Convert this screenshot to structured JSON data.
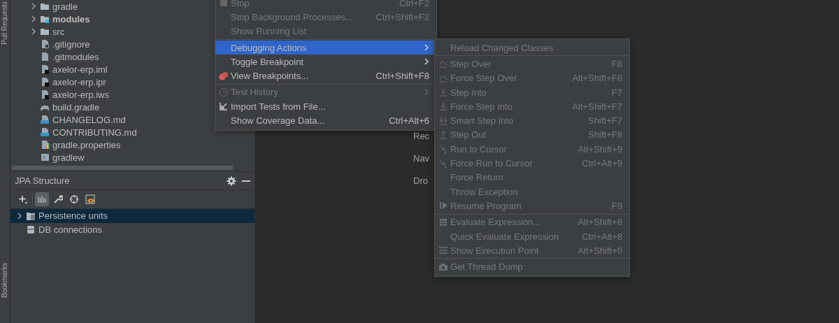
{
  "side_stripe": {
    "top_label": "Pull Requests",
    "bottom_label": "Bookmarks"
  },
  "project_tree": {
    "items": [
      {
        "label": "gradle",
        "kind": "folder",
        "expandable": true,
        "bold": false
      },
      {
        "label": "modules",
        "kind": "module",
        "expandable": true,
        "bold": true
      },
      {
        "label": "src",
        "kind": "folder",
        "expandable": true,
        "bold": false
      },
      {
        "label": ".gitignore",
        "kind": "ignore",
        "expandable": false,
        "bold": false
      },
      {
        "label": ".gitmodules",
        "kind": "text",
        "expandable": false,
        "bold": false
      },
      {
        "label": "axelor-erp.iml",
        "kind": "ide",
        "expandable": false,
        "bold": false
      },
      {
        "label": "axelor-erp.ipr",
        "kind": "ide",
        "expandable": false,
        "bold": false
      },
      {
        "label": "axelor-erp.iws",
        "kind": "ide",
        "expandable": false,
        "bold": false
      },
      {
        "label": "build.gradle",
        "kind": "gradle",
        "expandable": false,
        "bold": false
      },
      {
        "label": "CHANGELOG.md",
        "kind": "markdown",
        "expandable": false,
        "bold": false
      },
      {
        "label": "CONTRIBUTING.md",
        "kind": "markdown",
        "expandable": false,
        "bold": false
      },
      {
        "label": "gradle.properties",
        "kind": "properties",
        "expandable": false,
        "bold": false
      },
      {
        "label": "gradlew",
        "kind": "script",
        "expandable": false,
        "bold": false
      }
    ]
  },
  "jpa_panel": {
    "title": "JPA Structure",
    "toolbar": [
      {
        "kind": "add",
        "selected": false
      },
      {
        "kind": "bars",
        "selected": true
      },
      {
        "kind": "wrench",
        "selected": false
      },
      {
        "kind": "target",
        "selected": false
      },
      {
        "kind": "preview",
        "selected": false
      }
    ],
    "items": [
      {
        "label": "Persistence units",
        "kind": "units",
        "expandable": true,
        "selected": true
      },
      {
        "label": "DB connections",
        "kind": "database",
        "expandable": false,
        "selected": false
      }
    ]
  },
  "editor_hints": [
    "Rec",
    "Nav",
    "Dro"
  ],
  "run_menu": {
    "items": [
      {
        "kind": "item",
        "label": "Stop",
        "shortcut": "Ctrl+F2",
        "disabled": true,
        "selected": false,
        "submenu": false
      },
      {
        "kind": "item",
        "label": "Stop Background Processes...",
        "shortcut": "Ctrl+Shift+F2",
        "disabled": true,
        "selected": false,
        "submenu": false
      },
      {
        "kind": "item",
        "label": "Show Running List",
        "disabled": true,
        "selected": false,
        "submenu": false
      },
      {
        "kind": "separator"
      },
      {
        "kind": "item",
        "label": "Debugging Actions",
        "disabled": false,
        "selected": true,
        "submenu": true
      },
      {
        "kind": "item",
        "label": "Toggle Breakpoint",
        "disabled": false,
        "selected": false,
        "submenu": true
      },
      {
        "kind": "item",
        "label": "View Breakpoints...",
        "shortcut": "Ctrl+Shift+F8",
        "disabled": false,
        "selected": false,
        "submenu": false
      },
      {
        "kind": "separator"
      },
      {
        "kind": "item",
        "label": "Test History",
        "disabled": true,
        "selected": false,
        "submenu": true
      },
      {
        "kind": "item",
        "label": "Import Tests from File...",
        "disabled": false,
        "selected": false,
        "submenu": false
      },
      {
        "kind": "item",
        "label": "Show Coverage Data...",
        "shortcut": "Ctrl+Alt+6",
        "disabled": false,
        "selected": false,
        "submenu": false
      }
    ]
  },
  "debug_submenu": {
    "items": [
      {
        "kind": "item",
        "label": "Reload Changed Classes",
        "disabled": true
      },
      {
        "kind": "separator"
      },
      {
        "kind": "item",
        "label": "Step Over",
        "shortcut": "F8",
        "disabled": true
      },
      {
        "kind": "item",
        "label": "Force Step Over",
        "shortcut": "Alt+Shift+F8",
        "disabled": true
      },
      {
        "kind": "item",
        "label": "Step Into",
        "shortcut": "F7",
        "disabled": true
      },
      {
        "kind": "item",
        "label": "Force Step Into",
        "shortcut": "Alt+Shift+F7",
        "disabled": true
      },
      {
        "kind": "item",
        "label": "Smart Step Into",
        "shortcut": "Shift+F7",
        "disabled": true
      },
      {
        "kind": "item",
        "label": "Step Out",
        "shortcut": "Shift+F8",
        "disabled": true
      },
      {
        "kind": "item",
        "label": "Run to Cursor",
        "shortcut": "Alt+Shift+9",
        "disabled": true
      },
      {
        "kind": "item",
        "label": "Force Run to Cursor",
        "shortcut": "Ctrl+Alt+9",
        "disabled": true
      },
      {
        "kind": "item",
        "label": "Force Return",
        "disabled": true
      },
      {
        "kind": "item",
        "label": "Throw Exception",
        "disabled": true
      },
      {
        "kind": "item",
        "label": "Resume Program",
        "shortcut": "F9",
        "disabled": true
      },
      {
        "kind": "separator"
      },
      {
        "kind": "item",
        "label": "Evaluate Expression...",
        "shortcut": "Alt+Shift+8",
        "disabled": true
      },
      {
        "kind": "item",
        "label": "Quick Evaluate Expression",
        "shortcut": "Ctrl+Alt+8",
        "disabled": true
      },
      {
        "kind": "item",
        "label": "Show Execution Point",
        "shortcut": "Alt+Shift+0",
        "disabled": true
      },
      {
        "kind": "separator"
      },
      {
        "kind": "item",
        "label": "Get Thread Dump",
        "disabled": true
      }
    ]
  }
}
